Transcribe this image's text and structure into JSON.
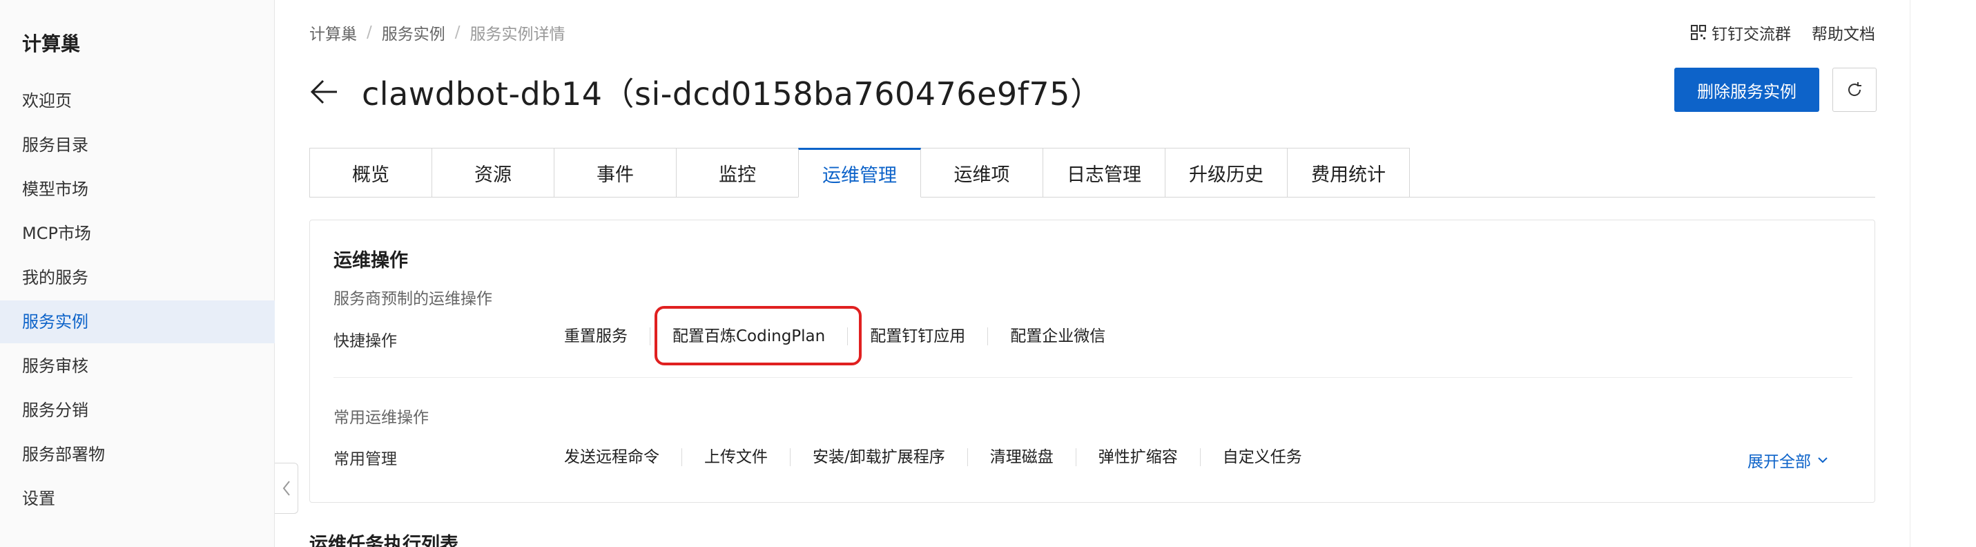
{
  "sidebar": {
    "brand": "计算巢",
    "items": [
      {
        "label": "欢迎页"
      },
      {
        "label": "服务目录"
      },
      {
        "label": "模型市场"
      },
      {
        "label": "MCP市场"
      },
      {
        "label": "我的服务"
      },
      {
        "label": "服务实例",
        "active": true
      },
      {
        "label": "服务审核"
      },
      {
        "label": "服务分销"
      },
      {
        "label": "服务部署物"
      },
      {
        "label": "设置"
      }
    ]
  },
  "breadcrumb": [
    "计算巢",
    "服务实例",
    "服务实例详情"
  ],
  "top_links": {
    "dingtalk_group": "钉钉交流群",
    "help_docs": "帮助文档"
  },
  "title": "clawdbot-db14（si-dcd0158ba760476e9f75）",
  "buttons": {
    "delete": "删除服务实例"
  },
  "tabs": [
    {
      "label": "概览"
    },
    {
      "label": "资源"
    },
    {
      "label": "事件"
    },
    {
      "label": "监控"
    },
    {
      "label": "运维管理",
      "active": true
    },
    {
      "label": "运维项"
    },
    {
      "label": "日志管理"
    },
    {
      "label": "升级历史"
    },
    {
      "label": "费用统计"
    }
  ],
  "ops_panel": {
    "title": "运维操作",
    "preset_subtitle": "服务商预制的运维操作",
    "quick_label": "快捷操作",
    "quick_ops": [
      "重置服务",
      "配置百炼CodingPlan",
      "配置钉钉应用",
      "配置企业微信"
    ],
    "common_subtitle": "常用运维操作",
    "common_label": "常用管理",
    "common_ops": [
      "发送远程命令",
      "上传文件",
      "安装/卸载扩展程序",
      "清理磁盘",
      "弹性扩缩容",
      "自定义任务"
    ],
    "expand_all": "展开全部"
  },
  "task_list_title": "运维任务执行列表",
  "colors": {
    "accent": "#0d63c9",
    "highlight": "#e02020"
  }
}
